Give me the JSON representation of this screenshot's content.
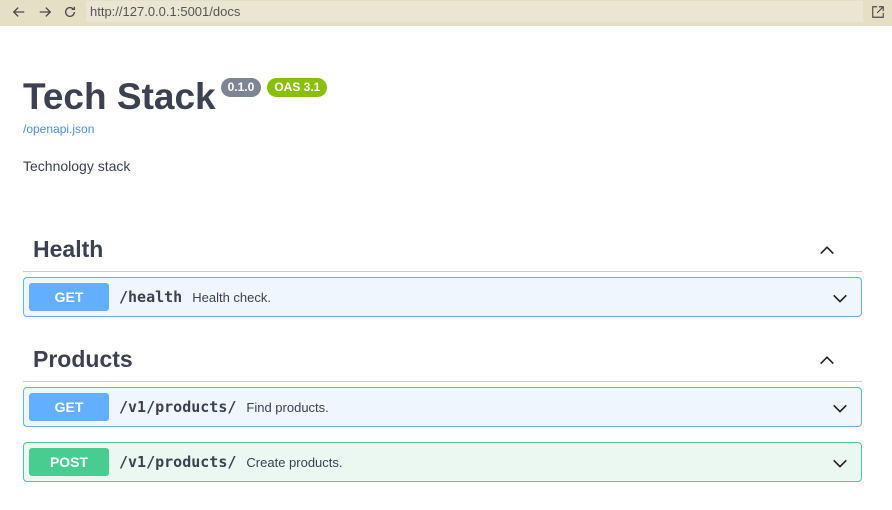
{
  "browser": {
    "url": "http://127.0.0.1:5001/docs",
    "icons": {
      "back": "arrow-left-icon",
      "forward": "arrow-right-icon",
      "reload": "reload-icon",
      "open_external": "open-external-icon"
    }
  },
  "info": {
    "title": "Tech Stack",
    "version": "0.1.0",
    "oas": "OAS 3.1",
    "spec_link": "/openapi.json",
    "description": "Technology stack"
  },
  "tags": [
    {
      "name": "Health",
      "operations": [
        {
          "method": "GET",
          "path": "/health",
          "summary": "Health check."
        }
      ]
    },
    {
      "name": "Products",
      "operations": [
        {
          "method": "GET",
          "path": "/v1/products/",
          "summary": "Find products."
        },
        {
          "method": "POST",
          "path": "/v1/products/",
          "summary": "Create products."
        }
      ]
    }
  ],
  "colors": {
    "get": "#61affe",
    "post": "#49cc90",
    "version_badge": "#7d8492",
    "oas_badge": "#89bf04",
    "link": "#4990e2"
  }
}
